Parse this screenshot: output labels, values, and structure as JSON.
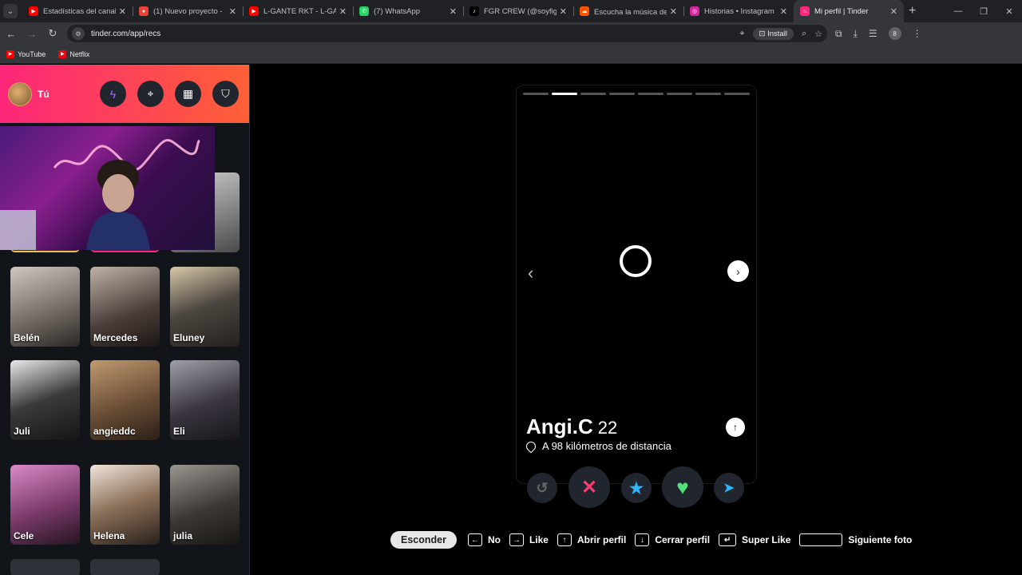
{
  "browser": {
    "tabs": [
      {
        "title": "Estadísticas del canal - Yo",
        "fav_color": "#ff0000",
        "fav_glyph": "▶"
      },
      {
        "title": "(1) Nuevo proyecto -",
        "fav_color": "#ea4335",
        "fav_glyph": "●"
      },
      {
        "title": "L-GANTE RKT - L-GANTE",
        "fav_color": "#ff0000",
        "fav_glyph": "▶"
      },
      {
        "title": "(7) WhatsApp",
        "fav_color": "#25d366",
        "fav_glyph": "✆"
      },
      {
        "title": "FGR CREW (@soyfiguero",
        "fav_color": "#000000",
        "fav_glyph": "♪"
      },
      {
        "title": "Escucha la música de ℱℊ",
        "fav_color": "#ff5500",
        "fav_glyph": "☁"
      },
      {
        "title": "Historias • Instagram",
        "fav_color": "#d6249f",
        "fav_glyph": "◎"
      },
      {
        "title": "Mi perfil | Tinder",
        "fav_color": "#fd267a",
        "fav_glyph": "♨",
        "active": true
      }
    ],
    "url": "tinder.com/app/recs",
    "install_label": "Install",
    "profile_initial": "8",
    "bookmarks": [
      {
        "label": "YouTube",
        "color": "#ff0000"
      },
      {
        "label": "Netflix",
        "color": "#e50914"
      }
    ]
  },
  "sidebar": {
    "user_label": "Tú",
    "cards": [
      {
        "name": "Belén",
        "bg": "linear-gradient(160deg,#cfc8c2,#6f6760 60%,#2b2826)"
      },
      {
        "name": "Mercedes",
        "bg": "linear-gradient(160deg,#bfb2a8,#4a3d38 60%,#1c1716)"
      },
      {
        "name": "Eluney",
        "bg": "linear-gradient(160deg,#d8c8a8,#4c4640 50%,#26211f)"
      },
      {
        "name": "Juli",
        "bg": "linear-gradient(160deg,#eaeaea,#3a3a3a 50%,#151515)"
      },
      {
        "name": "angieddc",
        "bg": "linear-gradient(160deg,#c09a70,#6a4e36 55%,#2a1f17)"
      },
      {
        "name": "Eli",
        "bg": "linear-gradient(160deg,#a0a0a8,#3a3540 55%,#18161a)"
      },
      {
        "name": "Cele",
        "bg": "linear-gradient(160deg,#d98ac7,#7a3a6a 55%,#241420)"
      },
      {
        "name": "Helena",
        "bg": "linear-gradient(160deg,#f0e6da,#8a6e58 50%,#2a211a)"
      },
      {
        "name": "julia",
        "bg": "linear-gradient(160deg,#9a9690,#3c3834 55%,#181614)"
      }
    ]
  },
  "profile": {
    "name": "Angi.C",
    "age": "22",
    "distance": "A 98 kilómetros de distancia",
    "photo_count": 8,
    "active_photo_index": 1
  },
  "hints": {
    "hide_label": "Esconder",
    "items": [
      {
        "key": "←",
        "label": "No"
      },
      {
        "key": "→",
        "label": "Like"
      },
      {
        "key": "↑",
        "label": "Abrir perfil"
      },
      {
        "key": "↓",
        "label": "Cerrar perfil"
      },
      {
        "key": "↵",
        "label": "Super Like"
      },
      {
        "key": "",
        "label": "Siguiente foto"
      }
    ]
  }
}
